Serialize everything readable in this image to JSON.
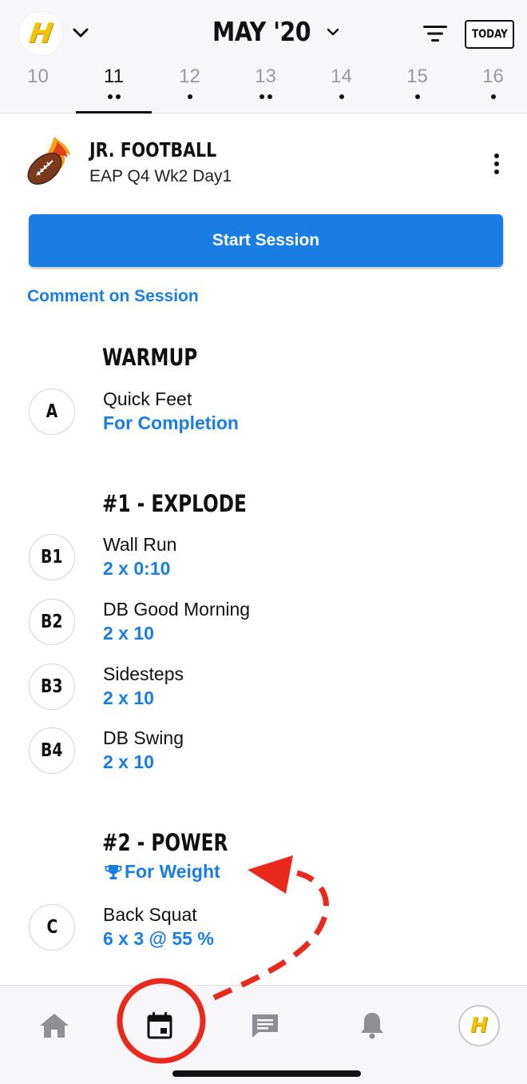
{
  "header": {
    "logo_letter": "H",
    "month_label": "MAY '20",
    "today_label": "TODAY",
    "days": [
      {
        "num": "10",
        "dots": 0,
        "active": false
      },
      {
        "num": "11",
        "dots": 2,
        "active": true
      },
      {
        "num": "12",
        "dots": 1,
        "active": false
      },
      {
        "num": "13",
        "dots": 2,
        "active": false
      },
      {
        "num": "14",
        "dots": 1,
        "active": false
      },
      {
        "num": "15",
        "dots": 1,
        "active": false
      },
      {
        "num": "16",
        "dots": 1,
        "active": false
      }
    ]
  },
  "program": {
    "title": "JR. FOOTBALL",
    "subtitle": "EAP Q4 Wk2 Day1"
  },
  "actions": {
    "start_label": "Start Session",
    "comment_label": "Comment on Session"
  },
  "sections": {
    "warmup": {
      "title": "WARMUP",
      "exercises": [
        {
          "badge": "A",
          "name": "Quick Feet",
          "detail": "For Completion"
        }
      ]
    },
    "explode": {
      "title": "#1 - EXPLODE",
      "exercises": [
        {
          "badge": "B1",
          "name": "Wall Run",
          "detail": "2 x 0:10"
        },
        {
          "badge": "B2",
          "name": "DB Good Morning",
          "detail": "2 x 10"
        },
        {
          "badge": "B3",
          "name": "Sidesteps",
          "detail": "2 x 10"
        },
        {
          "badge": "B4",
          "name": "DB Swing",
          "detail": "2 x 10"
        }
      ]
    },
    "power": {
      "title": "#2 - POWER",
      "tag": "For Weight",
      "exercises": [
        {
          "badge": "C",
          "name": "Back Squat",
          "detail": "6 x 3 @ 55 %"
        }
      ]
    }
  },
  "bottom_nav": {
    "items": [
      "home-icon",
      "calendar-icon",
      "chat-icon",
      "bell-icon",
      "profile-avatar"
    ],
    "active": "calendar-icon",
    "avatar_letter": "H"
  },
  "colors": {
    "accent": "#1a7de3",
    "annotation": "#e8291c",
    "logo_yellow": "#f2c200"
  }
}
